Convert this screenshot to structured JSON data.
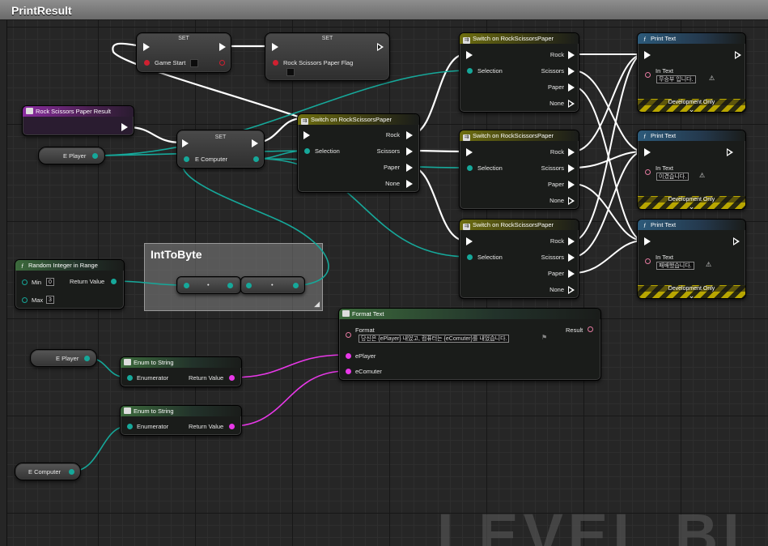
{
  "tab": {
    "title": "PrintResult"
  },
  "watermark": "LEVEL BLUEP",
  "comment": {
    "title": "IntToByte"
  },
  "set_nodes": [
    {
      "label": "SET",
      "var": "Game Start"
    },
    {
      "label": "SET",
      "var": "Rock Scissors Paper Flag"
    },
    {
      "label": "SET",
      "var": "E Computer"
    }
  ],
  "event_node": {
    "title": "Rock Scissors Paper Result"
  },
  "var_getters": {
    "eplayer_1": "E Player",
    "eplayer_2": "E Player",
    "ecomputer": "E Computer"
  },
  "random_node": {
    "title": "Random Integer in Range",
    "min_label": "Min",
    "min_value": "0",
    "max_label": "Max",
    "max_value": "3",
    "return": "Return Value"
  },
  "switch_main": {
    "title": "Switch on RockScissorsPaper",
    "selection": "Selection",
    "rock": "Rock",
    "scissors": "Scissors",
    "paper": "Paper",
    "none": "None"
  },
  "switch_nodes": [
    {
      "title": "Switch on RockScissorsPaper",
      "selection": "Selection",
      "rock": "Rock",
      "scissors": "Scissors",
      "paper": "Paper",
      "none": "None"
    },
    {
      "title": "Switch on RockScissorsPaper",
      "selection": "Selection",
      "rock": "Rock",
      "scissors": "Scissors",
      "paper": "Paper",
      "none": "None"
    },
    {
      "title": "Switch on RockScissorsPaper",
      "selection": "Selection",
      "rock": "Rock",
      "scissors": "Scissors",
      "paper": "Paper",
      "none": "None"
    }
  ],
  "print_nodes": [
    {
      "title": "Print Text",
      "in_text_label": "In Text",
      "in_text": "무승부 입니다.",
      "dev_only": "Development Only"
    },
    {
      "title": "Print Text",
      "in_text_label": "In Text",
      "in_text": "이겼습니다.",
      "dev_only": "Development Only"
    },
    {
      "title": "Print Text",
      "in_text_label": "In Text",
      "in_text": "패배했습니다.",
      "dev_only": "Development Only"
    }
  ],
  "format_node": {
    "title": "Format Text",
    "format_label": "Format",
    "format_value": "당신은 {ePlayer} 내었고, 컴퓨터는 {eComuter}를 내었습니다.",
    "result": "Result",
    "pin1": "ePlayer",
    "pin2": "eComuter"
  },
  "enum_nodes": [
    {
      "title": "Enum to String",
      "input": "Enumerator",
      "output": "Return Value"
    },
    {
      "title": "Enum to String",
      "input": "Enumerator",
      "output": "Return Value"
    }
  ],
  "colors": {
    "exec": "#ffffff",
    "byte": "#16a89a",
    "text": "#e838e8",
    "bool": "#d02030",
    "switch_header": "#6e6e10",
    "func_header": "#2c5a7a",
    "event_header": "#8a2ca0"
  }
}
